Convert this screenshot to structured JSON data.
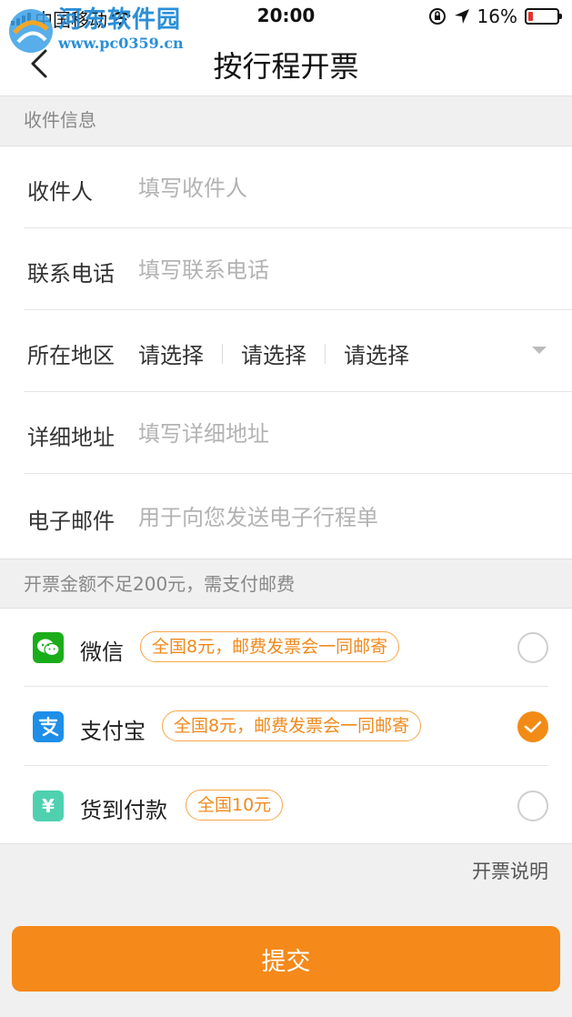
{
  "status_bar": {
    "carrier": "中国移动",
    "time": "20:00",
    "battery": "16%",
    "battery_level": 0.16
  },
  "watermark": {
    "title": "河东软件园",
    "url": "www.pc0359.cn"
  },
  "nav": {
    "title": "按行程开票"
  },
  "recipient_section": {
    "header": "收件信息",
    "fields": {
      "name": {
        "label": "收件人",
        "placeholder": "填写收件人"
      },
      "phone": {
        "label": "联系电话",
        "placeholder": "填写联系电话"
      },
      "region": {
        "label": "所在地区",
        "province": "请选择",
        "city": "请选择",
        "district": "请选择"
      },
      "address": {
        "label": "详细地址",
        "placeholder": "填写详细地址"
      },
      "email": {
        "label": "电子邮件",
        "placeholder": "用于向您发送电子行程单"
      }
    }
  },
  "payment_section": {
    "header": "开票金额不足200元，需支付邮费",
    "options": [
      {
        "name": "微信",
        "tag": "全国8元，邮费发票会一同邮寄",
        "checked": false,
        "icon": "wechat-icon",
        "color": "#1aad19"
      },
      {
        "name": "支付宝",
        "tag": "全国8元，邮费发票会一同邮寄",
        "checked": true,
        "icon": "alipay-icon",
        "color": "#1e8ee8"
      },
      {
        "name": "货到付款",
        "tag": "全国10元",
        "checked": false,
        "icon": "yuan-icon",
        "color": "#4fd1b0"
      }
    ]
  },
  "invoice_note": "开票说明",
  "submit_label": "提交",
  "colors": {
    "accent": "#f5891a",
    "tag_border": "#f5a64a"
  }
}
